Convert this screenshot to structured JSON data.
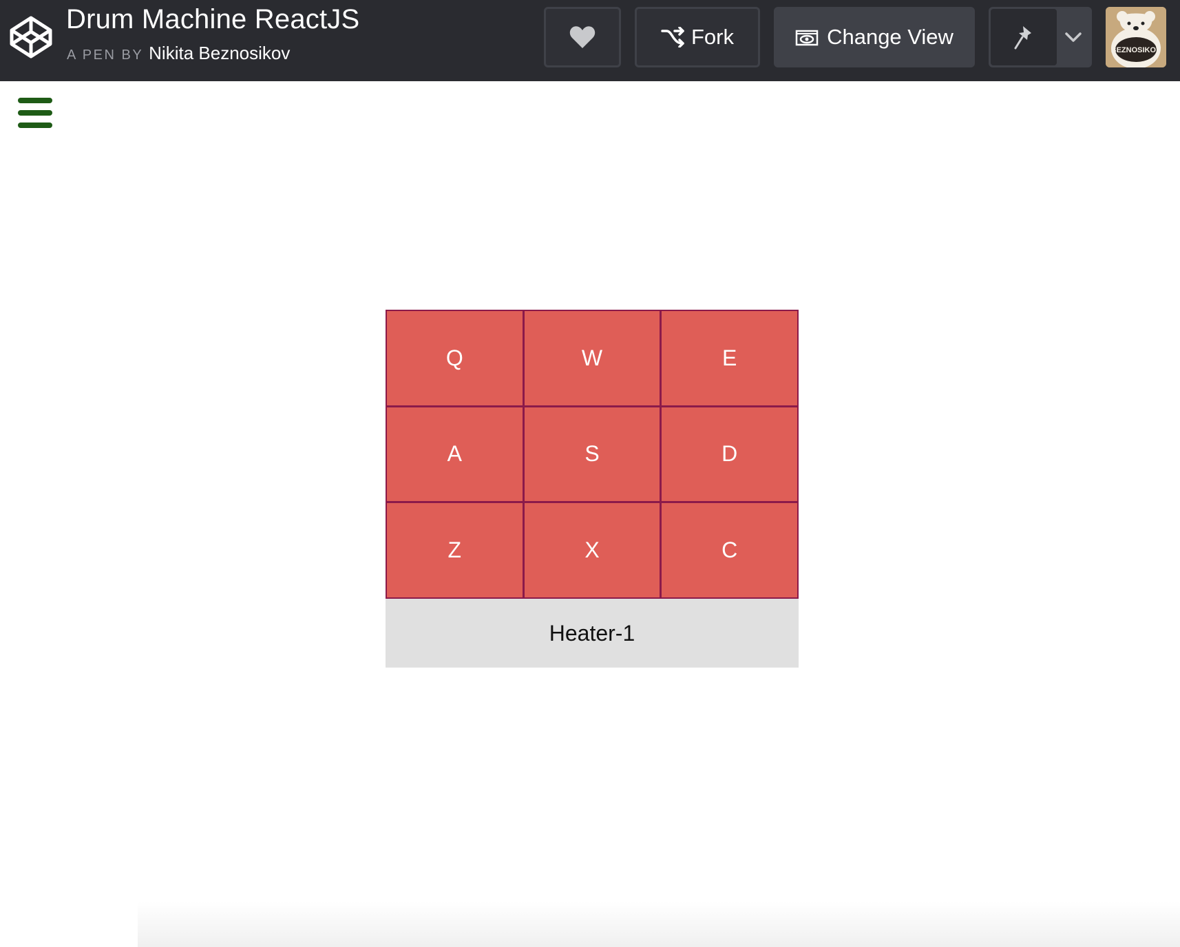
{
  "header": {
    "title": "Drum Machine ReactJS",
    "byline_prefix": "A PEN BY",
    "author": "Nikita Beznosikov",
    "buttons": {
      "heart_icon": "heart-icon",
      "fork_label": "Fork",
      "fork_icon": "fork-icon",
      "change_view_label": "Change View",
      "change_view_icon": "eye-icon",
      "pin_icon": "pin-icon",
      "dropdown_icon": "chevron-down-icon"
    },
    "avatar_icon": "bear-avatar",
    "avatar_text": "BEZNOSIKOV"
  },
  "menu": {
    "icon": "hamburger-icon",
    "color": "#1e5b16"
  },
  "drum_machine": {
    "pad_color": "#df5e57",
    "border_color": "#8b1a4a",
    "pads": [
      "Q",
      "W",
      "E",
      "A",
      "S",
      "D",
      "Z",
      "X",
      "C"
    ],
    "display": "Heater-1"
  }
}
